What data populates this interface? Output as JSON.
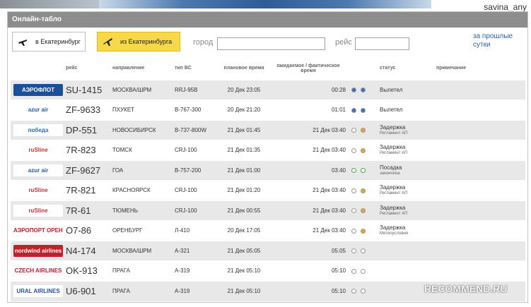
{
  "user_watermark": "savina_any",
  "panel": {
    "title": "Онлайн-табло"
  },
  "toolbar": {
    "to_btn": "в Екатеринбург",
    "from_btn": "из Екатеринбурга",
    "city_label": "город",
    "city_value": "",
    "flight_label": "рейс",
    "flight_value": "",
    "past_link": "за прошлые сутки"
  },
  "columns": {
    "flight": "рейс",
    "direction": "направление",
    "aircraft": "тип ВС",
    "planned": "плановое время",
    "expected": "ожидаемое / фактическое время",
    "status": "статус",
    "note": "примечание"
  },
  "rows": [
    {
      "logo": "АЭРОФЛОТ",
      "logo_bg": "#1a4f9c",
      "logo_fg": "#ffffff",
      "flight": "SU-1415",
      "direction": "МОСКВА/ШРМ",
      "aircraft": "RRJ-95B",
      "planned": "20 Дек 23:05",
      "expected": "00:28",
      "dot1": "#3b6fbf",
      "dot2": "#3b6fbf",
      "status": "Вылетел",
      "substatus": ""
    },
    {
      "logo": "azur air",
      "logo_bg": "#ffffff",
      "logo_fg": "#1f5fb2",
      "flight": "ZF-9633",
      "direction": "ПХУКЕТ",
      "aircraft": "B-767-300",
      "planned": "20 Дек 21:20",
      "expected": "01:01",
      "dot1": "#3b6fbf",
      "dot2": "#3b6fbf",
      "status": "Вылетел",
      "substatus": ""
    },
    {
      "logo": "победа",
      "logo_bg": "#ffffff",
      "logo_fg": "#2a6bbf",
      "flight": "DP-551",
      "direction": "НОВОСИБИРСК",
      "aircraft": "B-737-800W",
      "planned": "21 Дек 01:45",
      "expected": "21 Дек 03:40",
      "dot1": "#ffffff",
      "dot2": "#f0a030",
      "status": "Задержка",
      "substatus": "Регламент АП"
    },
    {
      "logo": "ruSline",
      "logo_bg": "#ffffff",
      "logo_fg": "#d43030",
      "flight": "7R-823",
      "direction": "ТОМСК",
      "aircraft": "CRJ-100",
      "planned": "21 Дек 01:35",
      "expected": "21 Дек 03:40",
      "dot1": "#ffffff",
      "dot2": "#f0a030",
      "status": "Задержка",
      "substatus": "Регламент АП"
    },
    {
      "logo": "azur air",
      "logo_bg": "#ffffff",
      "logo_fg": "#1f5fb2",
      "flight": "ZF-9627",
      "direction": "ГОА",
      "aircraft": "B-757-200",
      "planned": "21 Дек 01:00",
      "expected": "03:40",
      "dot1": "#ffffff",
      "dot2": "#ffffff",
      "dot_border": "#4aa84a",
      "status": "Посадка",
      "substatus": "закончена"
    },
    {
      "logo": "ruSline",
      "logo_bg": "#ffffff",
      "logo_fg": "#d43030",
      "flight": "7R-821",
      "direction": "КРАСНОЯРСК",
      "aircraft": "CRJ-100",
      "planned": "21 Дек 01:20",
      "expected": "21 Дек 03:40",
      "dot1": "#ffffff",
      "dot2": "#f0a030",
      "status": "Задержка",
      "substatus": "Регламент АП"
    },
    {
      "logo": "ruSline",
      "logo_bg": "#ffffff",
      "logo_fg": "#d43030",
      "flight": "7R-61",
      "direction": "ТЮМЕНЬ",
      "aircraft": "CRJ-100",
      "planned": "21 Дек 00:55",
      "expected": "21 Дек 03:40",
      "dot1": "#ffffff",
      "dot2": "#f0a030",
      "status": "Задержка",
      "substatus": "Регламент АП"
    },
    {
      "logo": "АЭРОПОРТ ОРЕНБУРГ",
      "logo_bg": "#ffffff",
      "logo_fg": "#c0202a",
      "flight": "O7-86",
      "direction": "ОРЕНБУРГ",
      "aircraft": "Л-410",
      "planned": "20 Дек 17:05",
      "expected": "21 Дек 03:40",
      "dot1": "#ffffff",
      "dot2": "#f0a030",
      "status": "Задержка",
      "substatus": "Метеоусловия"
    },
    {
      "logo": "nordwind airlines",
      "logo_bg": "#c0202a",
      "logo_fg": "#ffffff",
      "flight": "N4-174",
      "direction": "МОСКВА/ШРМ",
      "aircraft": "A-321",
      "planned": "21 Дек 05:05",
      "expected": "05:05",
      "dot1": "#ffffff",
      "dot2": "#ffffff",
      "status": "",
      "substatus": ""
    },
    {
      "logo": "CZECH AIRLINES",
      "logo_bg": "#ffffff",
      "logo_fg": "#c0202a",
      "flight": "OK-913",
      "direction": "ПРАГА",
      "aircraft": "A-319",
      "planned": "21 Дек 05:10",
      "expected": "05:10",
      "dot1": "#ffffff",
      "dot2": "#ffffff",
      "status": "",
      "substatus": ""
    },
    {
      "logo": "URAL AIRLINES",
      "logo_bg": "#ffffff",
      "logo_fg": "#2a4fa8",
      "flight": "U6-901",
      "direction": "ПРАГА",
      "aircraft": "A-319",
      "planned": "21 Дек 05:10",
      "expected": "05:10",
      "dot1": "#ffffff",
      "dot2": "#ffffff",
      "status": "",
      "substatus": ""
    }
  ],
  "recommend_watermark": "RECOMMEND.RU"
}
